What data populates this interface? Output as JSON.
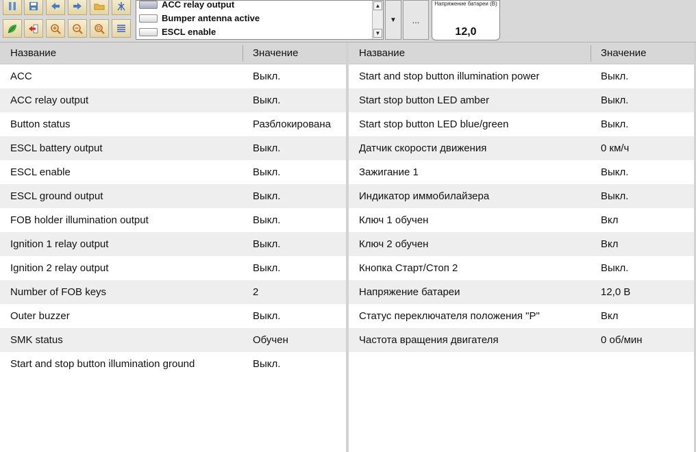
{
  "toolbar": {
    "buttons_row1": [
      "pause-icon",
      "save-icon",
      "back-icon",
      "forward-icon",
      "folder-icon",
      "antenna-icon"
    ],
    "buttons_row2": [
      "leaf-icon",
      "exit-icon",
      "zoom-in-icon",
      "zoom-out-icon",
      "zoom-fit-icon",
      "list-icon"
    ],
    "signal_list": [
      {
        "label": "ACC relay output",
        "selected": true
      },
      {
        "label": "Bumper antenna active",
        "selected": false
      },
      {
        "label": "ESCL enable",
        "selected": false
      }
    ],
    "more_label": "...",
    "gauge": {
      "label": "Напряжение батареи (В)",
      "value": "12,0"
    }
  },
  "left_table": {
    "header": {
      "name": "Название",
      "value": "Значение"
    },
    "rows": [
      {
        "name": "ACC",
        "value": "Выкл."
      },
      {
        "name": "ACC relay output",
        "value": "Выкл."
      },
      {
        "name": "Button status",
        "value": "Разблокирована"
      },
      {
        "name": "ESCL battery output",
        "value": "Выкл."
      },
      {
        "name": "ESCL enable",
        "value": "Выкл."
      },
      {
        "name": "ESCL ground output",
        "value": "Выкл."
      },
      {
        "name": "FOB holder illumination output",
        "value": "Выкл."
      },
      {
        "name": "Ignition 1 relay output",
        "value": "Выкл."
      },
      {
        "name": "Ignition 2 relay output",
        "value": "Выкл."
      },
      {
        "name": "Number of FOB keys",
        "value": "2"
      },
      {
        "name": "Outer buzzer",
        "value": "Выкл."
      },
      {
        "name": "SMK status",
        "value": "Обучен"
      },
      {
        "name": "Start and stop button illumination ground",
        "value": "Выкл."
      }
    ]
  },
  "right_table": {
    "header": {
      "name": "Название",
      "value": "Значение"
    },
    "rows": [
      {
        "name": "Start and stop button illumination power",
        "value": "Выкл."
      },
      {
        "name": "Start stop button LED amber",
        "value": "Выкл."
      },
      {
        "name": "Start stop button LED blue/green",
        "value": "Выкл."
      },
      {
        "name": "Датчик скорости движения",
        "value": "0 км/ч"
      },
      {
        "name": "Зажигание 1",
        "value": "Выкл."
      },
      {
        "name": "Индикатор иммобилайзера",
        "value": "Выкл."
      },
      {
        "name": "Ключ 1 обучен",
        "value": "Вкл"
      },
      {
        "name": "Ключ 2 обучен",
        "value": "Вкл"
      },
      {
        "name": "Кнопка Старт/Стоп 2",
        "value": "Выкл."
      },
      {
        "name": "Напряжение батареи",
        "value": "12,0 В"
      },
      {
        "name": "Статус переключателя положения \"P\"",
        "value": "Вкл"
      },
      {
        "name": "Частота вращения двигателя",
        "value": "0 об/мин"
      }
    ]
  }
}
